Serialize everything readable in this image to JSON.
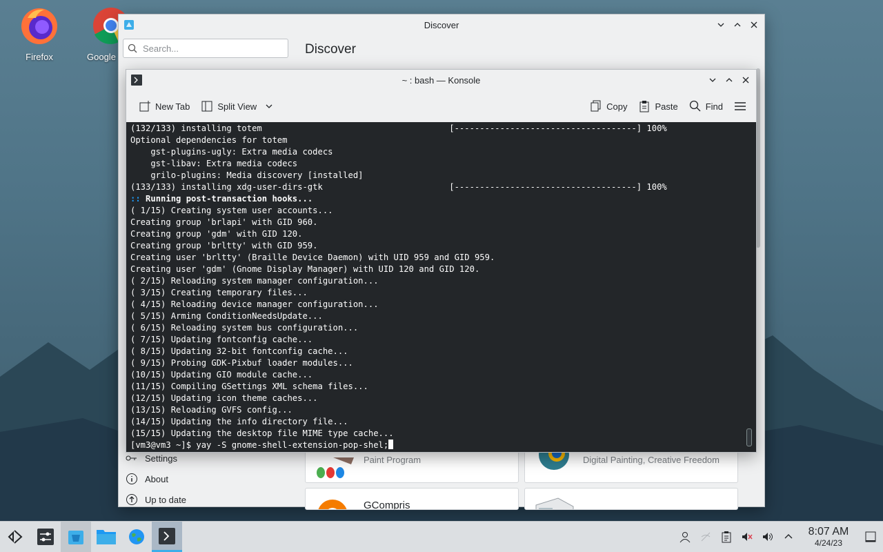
{
  "desktop": {
    "icons": [
      {
        "label": "Firefox"
      },
      {
        "label": "Google"
      }
    ]
  },
  "discover": {
    "title": "Discover",
    "search_placeholder": "Search...",
    "header": "Discover",
    "sidebar": {
      "settings": "Settings",
      "about": "About",
      "updates": "Up to date"
    },
    "cards": [
      {
        "subtitle": "Paint Program"
      },
      {
        "subtitle": "Digital Painting, Creative Freedom"
      },
      {
        "name": "GCompris"
      }
    ]
  },
  "konsole": {
    "title": "~ : bash — Konsole",
    "toolbar": {
      "new_tab": "New Tab",
      "split_view": "Split View",
      "copy": "Copy",
      "paste": "Paste",
      "find": "Find"
    },
    "lines": [
      {
        "text": "(132/133) installing totem                                     [------------------------------------] 100%",
        "style": ""
      },
      {
        "text": "Optional dependencies for totem",
        "style": ""
      },
      {
        "text": "    gst-plugins-ugly: Extra media codecs",
        "style": ""
      },
      {
        "text": "    gst-libav: Extra media codecs",
        "style": ""
      },
      {
        "text": "    grilo-plugins: Media discovery [installed]",
        "style": ""
      },
      {
        "text": "(133/133) installing xdg-user-dirs-gtk                         [------------------------------------] 100%",
        "style": ""
      },
      {
        "prefix": "::",
        "text": " Running post-transaction hooks...",
        "style": "bold"
      },
      {
        "text": "( 1/15) Creating system user accounts...",
        "style": ""
      },
      {
        "text": "Creating group 'brlapi' with GID 960.",
        "style": ""
      },
      {
        "text": "Creating group 'gdm' with GID 120.",
        "style": ""
      },
      {
        "text": "Creating group 'brltty' with GID 959.",
        "style": ""
      },
      {
        "text": "Creating user 'brltty' (Braille Device Daemon) with UID 959 and GID 959.",
        "style": ""
      },
      {
        "text": "Creating user 'gdm' (Gnome Display Manager) with UID 120 and GID 120.",
        "style": ""
      },
      {
        "text": "( 2/15) Reloading system manager configuration...",
        "style": ""
      },
      {
        "text": "( 3/15) Creating temporary files...",
        "style": ""
      },
      {
        "text": "( 4/15) Reloading device manager configuration...",
        "style": ""
      },
      {
        "text": "( 5/15) Arming ConditionNeedsUpdate...",
        "style": ""
      },
      {
        "text": "( 6/15) Reloading system bus configuration...",
        "style": ""
      },
      {
        "text": "( 7/15) Updating fontconfig cache...",
        "style": ""
      },
      {
        "text": "( 8/15) Updating 32-bit fontconfig cache...",
        "style": ""
      },
      {
        "text": "( 9/15) Probing GDK-Pixbuf loader modules...",
        "style": ""
      },
      {
        "text": "(10/15) Updating GIO module cache...",
        "style": ""
      },
      {
        "text": "(11/15) Compiling GSettings XML schema files...",
        "style": ""
      },
      {
        "text": "(12/15) Updating icon theme caches...",
        "style": ""
      },
      {
        "text": "(13/15) Reloading GVFS config...",
        "style": ""
      },
      {
        "text": "(14/15) Updating the info directory file...",
        "style": ""
      },
      {
        "text": "(15/15) Updating the desktop file MIME type cache...",
        "style": ""
      }
    ],
    "prompt": "[vm3@vm3 ~]$ yay -S gnome-shell-extension-pop-shel;"
  },
  "taskbar": {
    "icons": [
      "application-launcher-icon",
      "settings-sliders-icon",
      "discover-icon",
      "file-manager-icon",
      "browser-globe-icon",
      "konsole-icon"
    ],
    "clock_time": "8:07 AM",
    "clock_date": "4/24/23"
  },
  "colors": {
    "accent": "#3daee9",
    "terminal_bg": "#232629",
    "terminal_fg": "#fcfcfc",
    "prompt_hook": "#1d99f3"
  }
}
